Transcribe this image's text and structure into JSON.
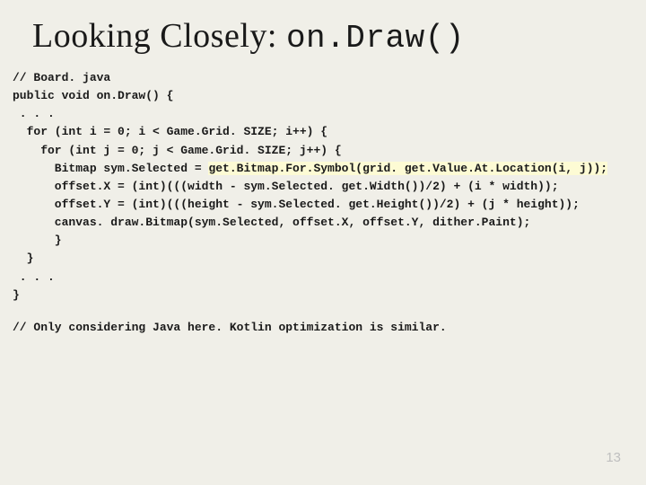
{
  "title": {
    "prefix": "Looking Closely: ",
    "mono": "on.Draw()"
  },
  "code": {
    "l01": "// Board. java",
    "l02": "public void on.Draw() {",
    "l03": " . . .",
    "l04": "  for (int i = 0; i < Game.Grid. SIZE; i++) {",
    "l05": "    for (int j = 0; j < Game.Grid. SIZE; j++) {",
    "l06a": "      Bitmap sym.Selected = ",
    "l06b": "get.Bitmap.For.Symbol(grid. get.Value.At.Location(i, j));",
    "l07": "      offset.X = (int)(((width - sym.Selected. get.Width())/2) + (i * width));",
    "l08": "      offset.Y = (int)(((height - sym.Selected. get.Height())/2) + (j * height));",
    "l09": "      canvas. draw.Bitmap(sym.Selected, offset.X, offset.Y, dither.Paint);",
    "l10": "      }",
    "l11": "  }",
    "l12": " . . .",
    "l13": "}"
  },
  "footnote": "// Only considering Java here. Kotlin optimization is similar.",
  "page_number": "13"
}
